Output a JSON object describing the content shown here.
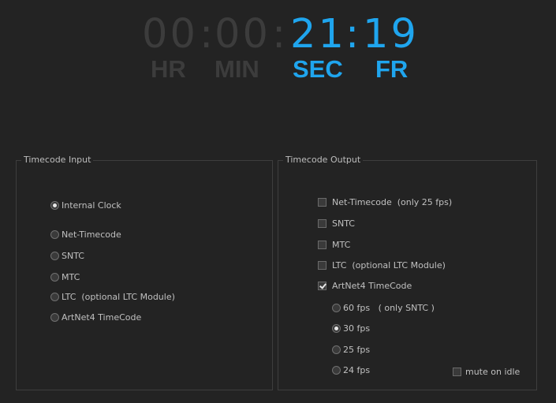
{
  "timecode": {
    "hours": "00",
    "minutes": "00",
    "seconds": "21",
    "frames": "19",
    "sep": ":",
    "units": {
      "hr": "HR",
      "min": "MIN",
      "sec": "SEC",
      "fr": "FR"
    },
    "colors": {
      "active": "#1fa5ee",
      "inactive": "#3c3c3c"
    }
  },
  "input": {
    "title": "Timecode Input",
    "options": [
      {
        "label": "Internal Clock",
        "selected": true
      },
      {
        "label": "Net-Timecode",
        "selected": false
      },
      {
        "label": "SNTC",
        "selected": false
      },
      {
        "label": "MTC",
        "selected": false
      },
      {
        "label": "LTC  (optional LTC Module)",
        "selected": false
      },
      {
        "label": "ArtNet4 TimeCode",
        "selected": false
      }
    ]
  },
  "output": {
    "title": "Timecode Output",
    "checks": [
      {
        "label": "Net-Timecode  (only 25 fps)",
        "checked": false
      },
      {
        "label": "SNTC",
        "checked": false
      },
      {
        "label": "MTC",
        "checked": false
      },
      {
        "label": "LTC  (optional LTC Module)",
        "checked": false
      },
      {
        "label": "ArtNet4 TimeCode",
        "checked": true
      }
    ],
    "fps": [
      {
        "label": "60 fps   ( only SNTC )",
        "selected": false
      },
      {
        "label": "30 fps",
        "selected": true
      },
      {
        "label": "25 fps",
        "selected": false
      },
      {
        "label": "24 fps",
        "selected": false
      }
    ],
    "mute": {
      "label": "mute on idle",
      "checked": false
    }
  }
}
